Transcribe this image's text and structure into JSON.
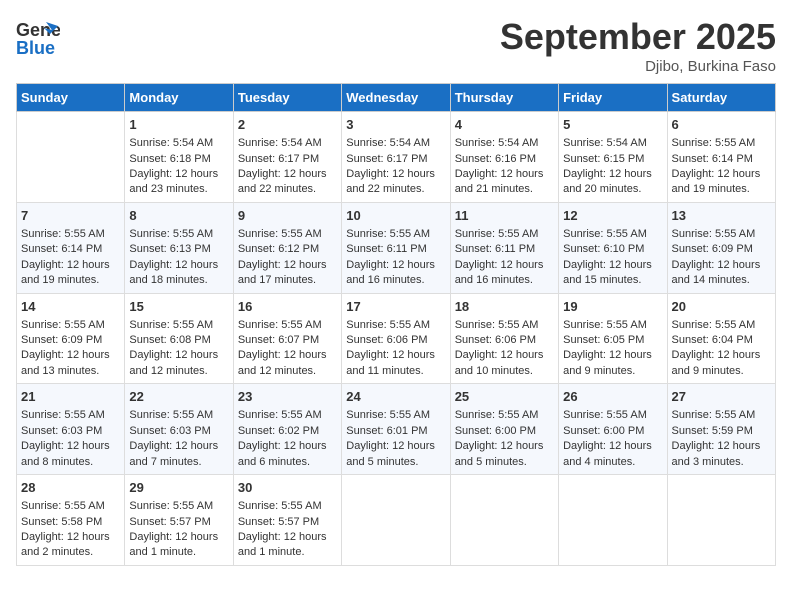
{
  "header": {
    "logo_line1": "General",
    "logo_line2": "Blue",
    "month": "September 2025",
    "location": "Djibo, Burkina Faso"
  },
  "weekdays": [
    "Sunday",
    "Monday",
    "Tuesday",
    "Wednesday",
    "Thursday",
    "Friday",
    "Saturday"
  ],
  "weeks": [
    [
      {
        "day": "",
        "sunrise": "",
        "sunset": "",
        "daylight": ""
      },
      {
        "day": "1",
        "sunrise": "Sunrise: 5:54 AM",
        "sunset": "Sunset: 6:18 PM",
        "daylight": "Daylight: 12 hours and 23 minutes."
      },
      {
        "day": "2",
        "sunrise": "Sunrise: 5:54 AM",
        "sunset": "Sunset: 6:17 PM",
        "daylight": "Daylight: 12 hours and 22 minutes."
      },
      {
        "day": "3",
        "sunrise": "Sunrise: 5:54 AM",
        "sunset": "Sunset: 6:17 PM",
        "daylight": "Daylight: 12 hours and 22 minutes."
      },
      {
        "day": "4",
        "sunrise": "Sunrise: 5:54 AM",
        "sunset": "Sunset: 6:16 PM",
        "daylight": "Daylight: 12 hours and 21 minutes."
      },
      {
        "day": "5",
        "sunrise": "Sunrise: 5:54 AM",
        "sunset": "Sunset: 6:15 PM",
        "daylight": "Daylight: 12 hours and 20 minutes."
      },
      {
        "day": "6",
        "sunrise": "Sunrise: 5:55 AM",
        "sunset": "Sunset: 6:14 PM",
        "daylight": "Daylight: 12 hours and 19 minutes."
      }
    ],
    [
      {
        "day": "7",
        "sunrise": "Sunrise: 5:55 AM",
        "sunset": "Sunset: 6:14 PM",
        "daylight": "Daylight: 12 hours and 19 minutes."
      },
      {
        "day": "8",
        "sunrise": "Sunrise: 5:55 AM",
        "sunset": "Sunset: 6:13 PM",
        "daylight": "Daylight: 12 hours and 18 minutes."
      },
      {
        "day": "9",
        "sunrise": "Sunrise: 5:55 AM",
        "sunset": "Sunset: 6:12 PM",
        "daylight": "Daylight: 12 hours and 17 minutes."
      },
      {
        "day": "10",
        "sunrise": "Sunrise: 5:55 AM",
        "sunset": "Sunset: 6:11 PM",
        "daylight": "Daylight: 12 hours and 16 minutes."
      },
      {
        "day": "11",
        "sunrise": "Sunrise: 5:55 AM",
        "sunset": "Sunset: 6:11 PM",
        "daylight": "Daylight: 12 hours and 16 minutes."
      },
      {
        "day": "12",
        "sunrise": "Sunrise: 5:55 AM",
        "sunset": "Sunset: 6:10 PM",
        "daylight": "Daylight: 12 hours and 15 minutes."
      },
      {
        "day": "13",
        "sunrise": "Sunrise: 5:55 AM",
        "sunset": "Sunset: 6:09 PM",
        "daylight": "Daylight: 12 hours and 14 minutes."
      }
    ],
    [
      {
        "day": "14",
        "sunrise": "Sunrise: 5:55 AM",
        "sunset": "Sunset: 6:09 PM",
        "daylight": "Daylight: 12 hours and 13 minutes."
      },
      {
        "day": "15",
        "sunrise": "Sunrise: 5:55 AM",
        "sunset": "Sunset: 6:08 PM",
        "daylight": "Daylight: 12 hours and 12 minutes."
      },
      {
        "day": "16",
        "sunrise": "Sunrise: 5:55 AM",
        "sunset": "Sunset: 6:07 PM",
        "daylight": "Daylight: 12 hours and 12 minutes."
      },
      {
        "day": "17",
        "sunrise": "Sunrise: 5:55 AM",
        "sunset": "Sunset: 6:06 PM",
        "daylight": "Daylight: 12 hours and 11 minutes."
      },
      {
        "day": "18",
        "sunrise": "Sunrise: 5:55 AM",
        "sunset": "Sunset: 6:06 PM",
        "daylight": "Daylight: 12 hours and 10 minutes."
      },
      {
        "day": "19",
        "sunrise": "Sunrise: 5:55 AM",
        "sunset": "Sunset: 6:05 PM",
        "daylight": "Daylight: 12 hours and 9 minutes."
      },
      {
        "day": "20",
        "sunrise": "Sunrise: 5:55 AM",
        "sunset": "Sunset: 6:04 PM",
        "daylight": "Daylight: 12 hours and 9 minutes."
      }
    ],
    [
      {
        "day": "21",
        "sunrise": "Sunrise: 5:55 AM",
        "sunset": "Sunset: 6:03 PM",
        "daylight": "Daylight: 12 hours and 8 minutes."
      },
      {
        "day": "22",
        "sunrise": "Sunrise: 5:55 AM",
        "sunset": "Sunset: 6:03 PM",
        "daylight": "Daylight: 12 hours and 7 minutes."
      },
      {
        "day": "23",
        "sunrise": "Sunrise: 5:55 AM",
        "sunset": "Sunset: 6:02 PM",
        "daylight": "Daylight: 12 hours and 6 minutes."
      },
      {
        "day": "24",
        "sunrise": "Sunrise: 5:55 AM",
        "sunset": "Sunset: 6:01 PM",
        "daylight": "Daylight: 12 hours and 5 minutes."
      },
      {
        "day": "25",
        "sunrise": "Sunrise: 5:55 AM",
        "sunset": "Sunset: 6:00 PM",
        "daylight": "Daylight: 12 hours and 5 minutes."
      },
      {
        "day": "26",
        "sunrise": "Sunrise: 5:55 AM",
        "sunset": "Sunset: 6:00 PM",
        "daylight": "Daylight: 12 hours and 4 minutes."
      },
      {
        "day": "27",
        "sunrise": "Sunrise: 5:55 AM",
        "sunset": "Sunset: 5:59 PM",
        "daylight": "Daylight: 12 hours and 3 minutes."
      }
    ],
    [
      {
        "day": "28",
        "sunrise": "Sunrise: 5:55 AM",
        "sunset": "Sunset: 5:58 PM",
        "daylight": "Daylight: 12 hours and 2 minutes."
      },
      {
        "day": "29",
        "sunrise": "Sunrise: 5:55 AM",
        "sunset": "Sunset: 5:57 PM",
        "daylight": "Daylight: 12 hours and 1 minute."
      },
      {
        "day": "30",
        "sunrise": "Sunrise: 5:55 AM",
        "sunset": "Sunset: 5:57 PM",
        "daylight": "Daylight: 12 hours and 1 minute."
      },
      {
        "day": "",
        "sunrise": "",
        "sunset": "",
        "daylight": ""
      },
      {
        "day": "",
        "sunrise": "",
        "sunset": "",
        "daylight": ""
      },
      {
        "day": "",
        "sunrise": "",
        "sunset": "",
        "daylight": ""
      },
      {
        "day": "",
        "sunrise": "",
        "sunset": "",
        "daylight": ""
      }
    ]
  ]
}
